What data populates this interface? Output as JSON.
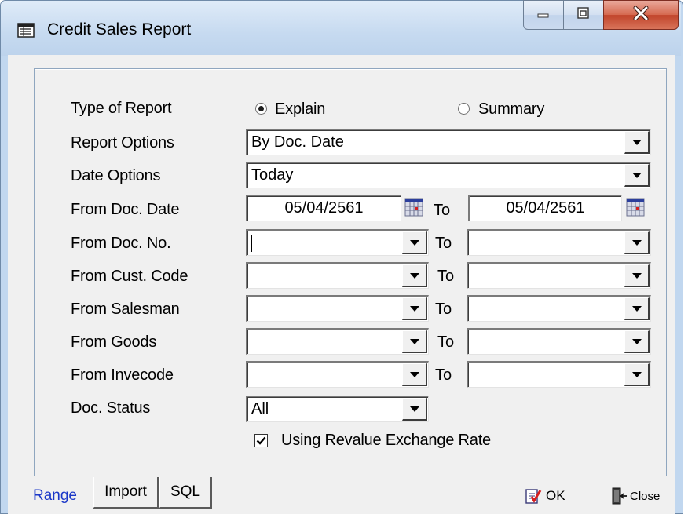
{
  "window": {
    "title": "Credit Sales Report",
    "icon": "report-icon"
  },
  "form": {
    "type_of_report": {
      "label": "Type of Report",
      "options": [
        "Explain",
        "Summary"
      ],
      "selected": "Explain"
    },
    "report_options": {
      "label": "Report Options",
      "value": "By Doc. Date"
    },
    "date_options": {
      "label": "Date Options",
      "value": "Today"
    },
    "from_doc_date": {
      "label": "From Doc. Date",
      "from": "05/04/2561",
      "to_label": "To",
      "to": "05/04/2561"
    },
    "from_doc_no": {
      "label": "From Doc. No.",
      "from": "",
      "to_label": "To",
      "to": ""
    },
    "from_cust_code": {
      "label": "From Cust. Code",
      "from": "",
      "to_label": "To",
      "to": ""
    },
    "from_salesman": {
      "label": "From Salesman",
      "from": "",
      "to_label": "To",
      "to": ""
    },
    "from_goods": {
      "label": "From Goods",
      "from": "",
      "to_label": "To",
      "to": ""
    },
    "from_invecode": {
      "label": "From Invecode",
      "from": "",
      "to_label": "To",
      "to": ""
    },
    "doc_status": {
      "label": "Doc. Status",
      "value": "All"
    },
    "revalue": {
      "label": "Using Revalue Exchange Rate",
      "checked": true
    }
  },
  "tabs": [
    {
      "label": "Range",
      "active": true
    },
    {
      "label": "Import",
      "active": false
    },
    {
      "label": "SQL",
      "active": false
    }
  ],
  "buttons": {
    "ok": "OK",
    "close": "Close"
  },
  "colors": {
    "active_tab_text": "#1a37c8",
    "window_frame": "#c1d7ef",
    "close_button": "#c0432a"
  }
}
